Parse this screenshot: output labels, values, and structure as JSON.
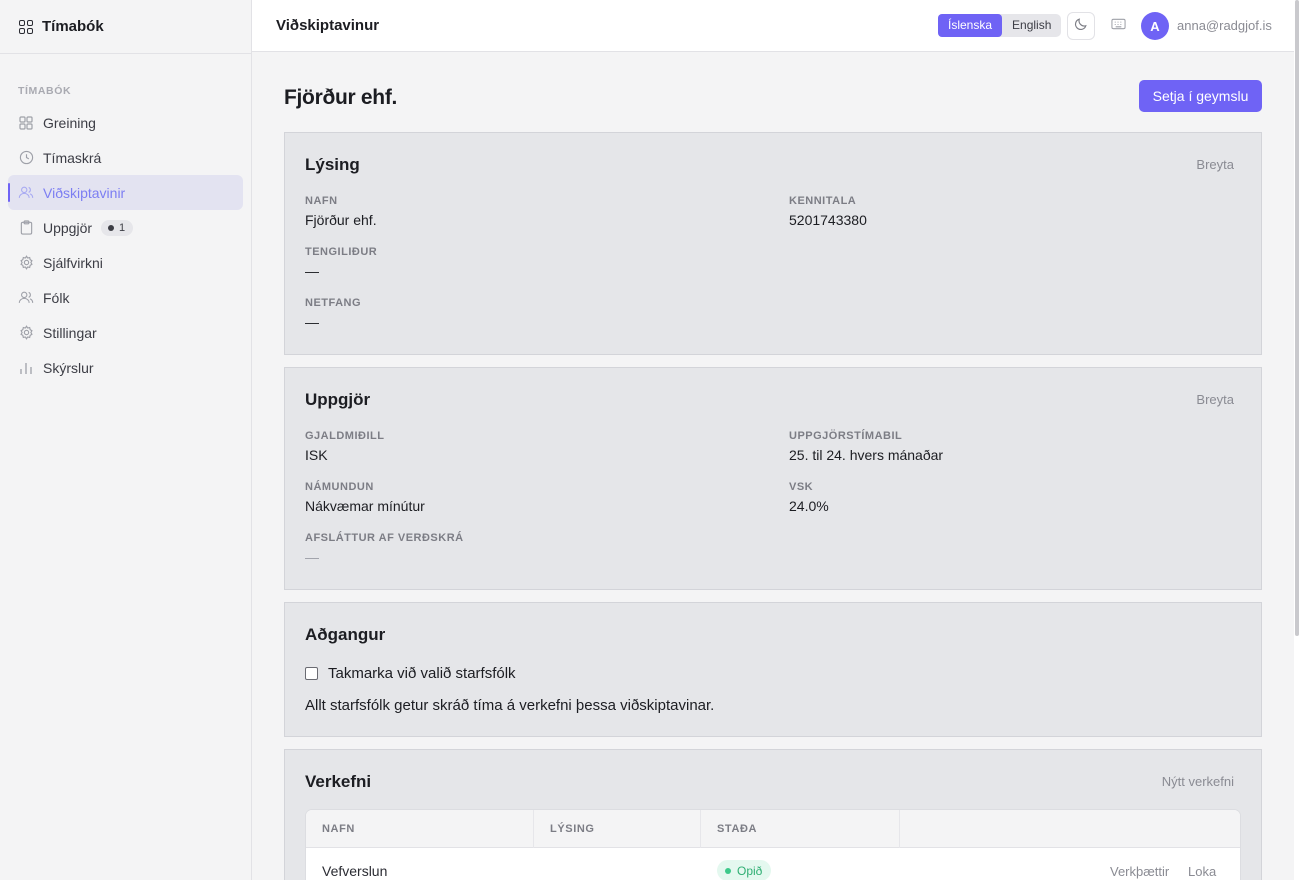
{
  "brand": {
    "name": "Tímabók"
  },
  "sidebar": {
    "section_label": "TÍMABÓK",
    "items": [
      {
        "label": "Greining",
        "icon": "grid-icon"
      },
      {
        "label": "Tímaskrá",
        "icon": "clock-icon"
      },
      {
        "label": "Viðskiptavinir",
        "icon": "users-icon",
        "active": true
      },
      {
        "label": "Uppgjör",
        "icon": "clipboard-icon",
        "badge": "1"
      },
      {
        "label": "Sjálfvirkni",
        "icon": "gear-icon"
      },
      {
        "label": "Fólk",
        "icon": "people-icon"
      },
      {
        "label": "Stillingar",
        "icon": "settings-icon"
      },
      {
        "label": "Skýrslur",
        "icon": "bar-chart-icon"
      }
    ]
  },
  "topbar": {
    "title": "Viðskiptavinur",
    "lang_is": "Íslenska",
    "lang_en": "English",
    "avatar_initial": "A",
    "user_email": "anna@radgjof.is"
  },
  "page": {
    "title": "Fjörður ehf.",
    "archive_label": "Setja í geymslu"
  },
  "description": {
    "title": "Lýsing",
    "edit_label": "Breyta",
    "name_label": "NAFN",
    "name_value": "Fjörður ehf.",
    "kennitala_label": "KENNITALA",
    "kennitala_value": "5201743380",
    "contact_label": "TENGILIÐUR",
    "contact_value": "—",
    "email_label": "NETFANG",
    "email_value": "—"
  },
  "settlement": {
    "title": "Uppgjör",
    "edit_label": "Breyta",
    "currency_label": "GJALDMIÐILL",
    "currency_value": "ISK",
    "period_label": "UPPGJÖRSTÍMABIL",
    "period_value": "25. til 24. hvers mánaðar",
    "rounding_label": "NÁMUNDUN",
    "rounding_value": "Nákvæmar mínútur",
    "vat_label": "VSK",
    "vat_value": "24.0%",
    "discount_label": "AFSLÁTTUR AF VERÐSKRÁ",
    "discount_value": "—"
  },
  "access": {
    "title": "Aðgangur",
    "restrict_label": "Takmarka við valið starfsfólk",
    "note": "Allt starfsfólk getur skráð tíma á verkefni þessa viðskiptavinar."
  },
  "projects": {
    "title": "Verkefni",
    "new_label": "Nýtt verkefni",
    "columns": [
      "NAFN",
      "LÝSING",
      "STAÐA"
    ],
    "rows": [
      {
        "name": "Vefverslun",
        "description": "",
        "status": "Opið",
        "action_tasks": "Verkþættir",
        "action_close": "Loka"
      }
    ]
  },
  "colors": {
    "accent": "#6f63f5",
    "status_open": "#2fae73"
  }
}
